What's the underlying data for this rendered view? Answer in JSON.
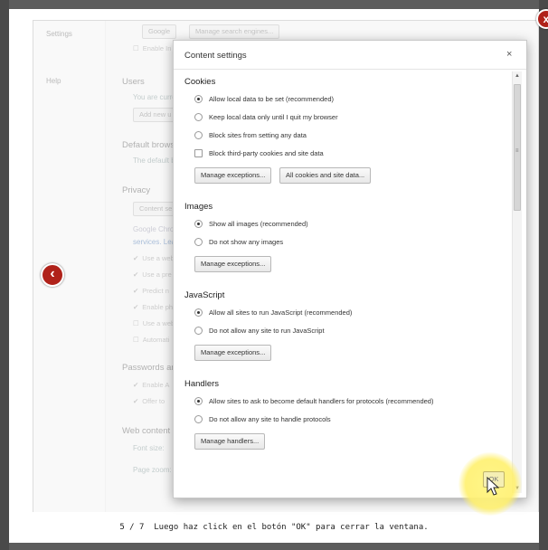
{
  "lightbox": {
    "close_glyph": "x",
    "prev_glyph": "‹",
    "caption_counter": "5 / 7",
    "caption_text": "Luego haz click en el botón \"OK\" para cerrar la ventana."
  },
  "background_settings": {
    "nav": [
      "Settings",
      "Help"
    ],
    "search_engine_value": "Google",
    "manage_search_engines": "Manage search engines...",
    "enable_instant": "Enable In",
    "users_heading": "Users",
    "users_text": "You are curre",
    "add_user": "Add new u",
    "default_browser_heading": "Default brows",
    "default_browser_text": "The default b",
    "privacy_heading": "Privacy",
    "content_settings_btn": "Content se",
    "google_chrome_text": "Google Chro",
    "services_text": "services. Lea",
    "privacy_options": [
      "Use a web",
      "Use a pre",
      "Predict n",
      "Enable ph",
      "Use a web",
      "Automati"
    ],
    "passwords_heading": "Passwords anc",
    "password_options": [
      "Enable A",
      "Offer to"
    ],
    "web_content_heading": "Web content",
    "font_size": "Font size:",
    "page_zoom": "Page zoom:"
  },
  "dialog": {
    "title": "Content settings",
    "close": "×",
    "cookies": {
      "title": "Cookies",
      "options": [
        "Allow local data to be set (recommended)",
        "Keep local data only until I quit my browser",
        "Block sites from setting any data"
      ],
      "checkbox": "Block third-party cookies and site data",
      "buttons": [
        "Manage exceptions...",
        "All cookies and site data..."
      ]
    },
    "images": {
      "title": "Images",
      "options": [
        "Show all images (recommended)",
        "Do not show any images"
      ],
      "button": "Manage exceptions..."
    },
    "javascript": {
      "title": "JavaScript",
      "options": [
        "Allow all sites to run JavaScript (recommended)",
        "Do not allow any site to run JavaScript"
      ],
      "button": "Manage exceptions..."
    },
    "handlers": {
      "title": "Handlers",
      "options": [
        "Allow sites to ask to become default handlers for protocols (recommended)",
        "Do not allow any site to handle protocols"
      ],
      "button": "Manage handlers..."
    },
    "ok_label": "OK"
  },
  "icons": {
    "lightbox_close": "close-icon",
    "lightbox_prev": "chevron-left-icon",
    "cursor": "mouse-pointer-icon"
  },
  "colors": {
    "accent_red": "#b0221a",
    "highlight_yellow": "#fff36e"
  }
}
